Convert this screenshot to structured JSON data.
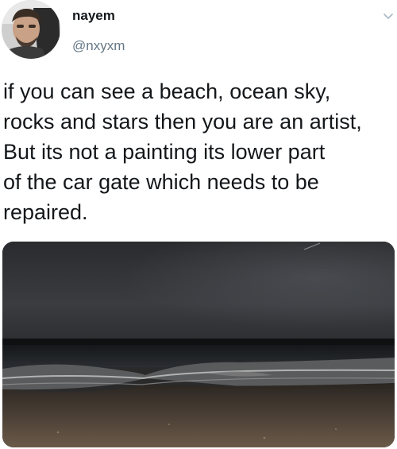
{
  "tweet": {
    "display_name": "nayem",
    "handle": "@nxyxm",
    "text": "if you can see a beach, ocean sky,\nrocks and stars then you are an artist,\nBut its not a painting its lower part\nof the car gate which needs to be\nrepaired.",
    "menu_icon": "chevron-down-icon",
    "avatar_icon": "avatar"
  },
  "colors": {
    "name": "#14171a",
    "handle": "#657786",
    "text": "#14171a"
  }
}
